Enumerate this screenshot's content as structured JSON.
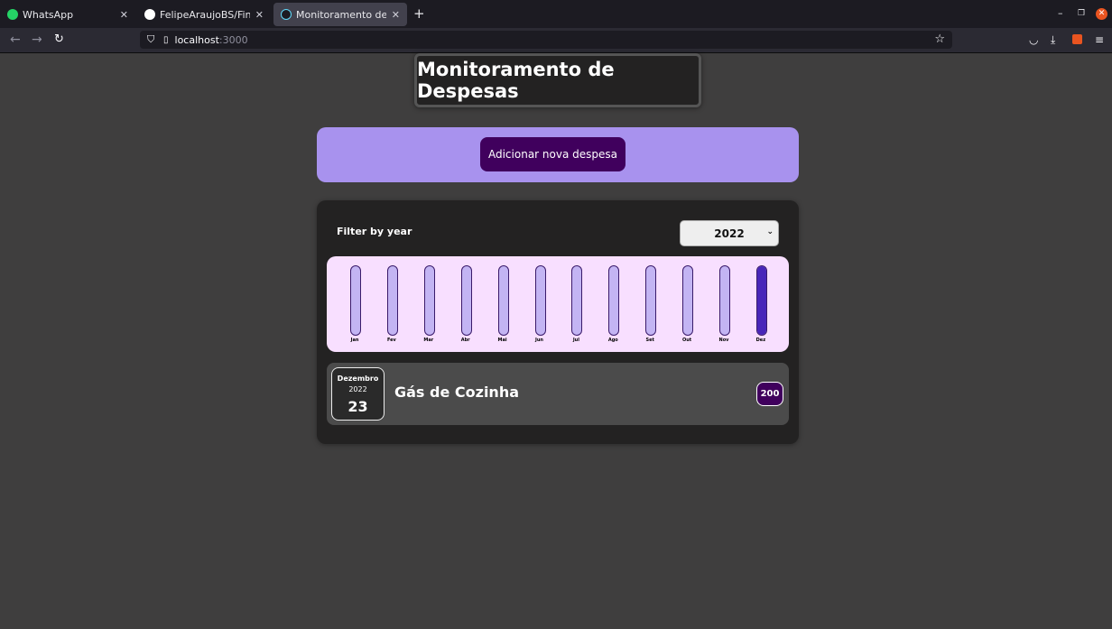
{
  "browser": {
    "tabs": [
      {
        "title": "WhatsApp",
        "icon": "whatsapp-icon",
        "active": false
      },
      {
        "title": "FelipeAraujoBS/Finances",
        "icon": "github-icon",
        "active": false
      },
      {
        "title": "Monitoramento de Despe",
        "icon": "react-icon",
        "active": true
      }
    ],
    "url_host": "localhost",
    "url_port": ":3000"
  },
  "page": {
    "title": "Monitoramento de Despesas",
    "add_button": "Adicionar nova despesa",
    "filter_label": "Filter by year",
    "selected_year": "2022"
  },
  "chart_data": {
    "type": "bar",
    "categories": [
      "Jan",
      "Fev",
      "Mar",
      "Abr",
      "Mai",
      "Jun",
      "Jul",
      "Ago",
      "Set",
      "Out",
      "Nov",
      "Dez"
    ],
    "values": [
      0,
      0,
      0,
      0,
      0,
      0,
      0,
      0,
      0,
      0,
      0,
      200
    ],
    "ylim": [
      0,
      200
    ]
  },
  "expenses": [
    {
      "month": "Dezembro",
      "year": "2022",
      "day": "23",
      "title": "Gás de Cozinha",
      "amount": "200"
    }
  ],
  "colors": {
    "accent": "#40005d",
    "new_expense_bg": "#a892ee",
    "chart_bg": "#f8dfff",
    "bar_fill": "#4826b9"
  }
}
